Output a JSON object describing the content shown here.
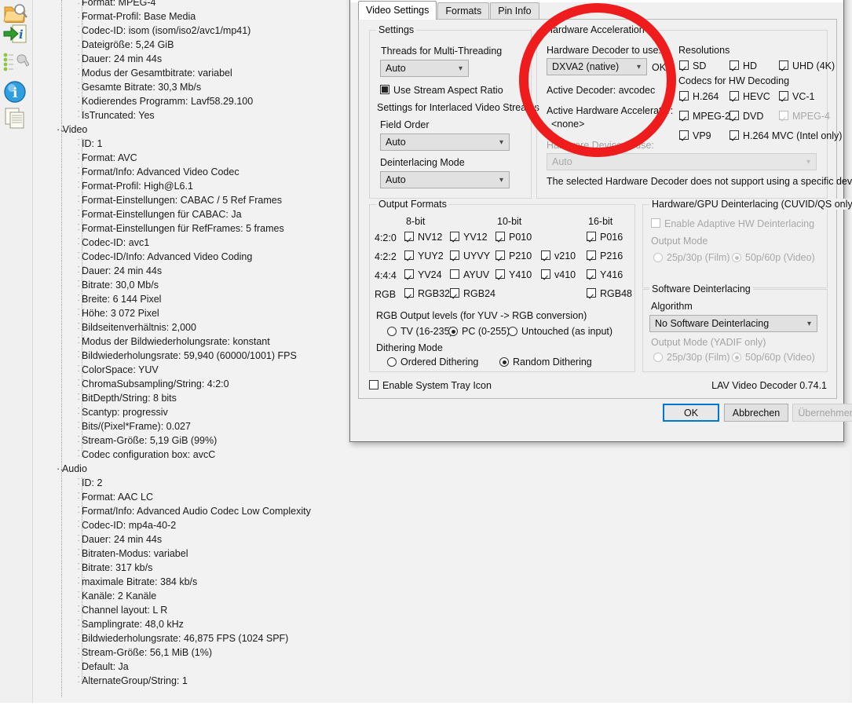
{
  "app": {
    "rail_icons": [
      {
        "name": "folder-search-icon"
      },
      {
        "name": "import-info-icon"
      },
      {
        "name": "tools-wrench-icon"
      },
      {
        "name": "info-circle-icon"
      },
      {
        "name": "copy-document-icon"
      }
    ]
  },
  "tree": {
    "groups": [
      {
        "label": "",
        "items": [
          "Format: MPEG-4",
          "Format-Profil: Base Media",
          "Codec-ID: isom (isom/iso2/avc1/mp41)",
          "Dateigröße: 5,24 GiB",
          "Dauer: 24 min 44s",
          "Modus der Gesamtbitrate: variabel",
          "Gesamte Bitrate: 30,3 Mb/s",
          "Kodierendes Programm: Lavf58.29.100",
          "IsTruncated: Yes"
        ]
      },
      {
        "label": "Video",
        "items": [
          "ID: 1",
          "Format: AVC",
          "Format/Info: Advanced Video Codec",
          "Format-Profil: High@L6.1",
          "Format-Einstellungen: CABAC / 5 Ref Frames",
          "Format-Einstellungen für CABAC: Ja",
          "Format-Einstellungen für RefFrames: 5 frames",
          "Codec-ID: avc1",
          "Codec-ID/Info: Advanced Video Coding",
          "Dauer: 24 min 44s",
          "Bitrate: 30,0 Mb/s",
          "Breite: 6 144 Pixel",
          "Höhe: 3 072 Pixel",
          "Bildseitenverhältnis: 2,000",
          "Modus der Bildwiederholungsrate: konstant",
          "Bildwiederholungsrate: 59,940 (60000/1001) FPS",
          "ColorSpace: YUV",
          "ChromaSubsampling/String: 4:2:0",
          "BitDepth/String: 8 bits",
          "Scantyp: progressiv",
          "Bits/(Pixel*Frame): 0.027",
          "Stream-Größe: 5,19 GiB (99%)",
          "Codec configuration box: avcC"
        ]
      },
      {
        "label": "Audio",
        "items": [
          "ID: 2",
          "Format: AAC LC",
          "Format/Info: Advanced Audio Codec Low Complexity",
          "Codec-ID: mp4a-40-2",
          "Dauer: 24 min 44s",
          "Bitraten-Modus: variabel",
          "Bitrate: 317 kb/s",
          "maximale Bitrate: 384 kb/s",
          "Kanäle: 2 Kanäle",
          "Channel layout: L R",
          "Samplingrate: 48,0 kHz",
          "Bildwiederholungsrate: 46,875 FPS (1024 SPF)",
          "Stream-Größe: 56,1 MiB (1%)",
          "Default: Ja",
          "AlternateGroup/String: 1"
        ]
      }
    ]
  },
  "dialog": {
    "title": "",
    "tabs": [
      {
        "label": "Video Settings",
        "active": true
      },
      {
        "label": "Formats",
        "active": false
      },
      {
        "label": "Pin Info",
        "active": false
      }
    ],
    "settings_group": {
      "legend": "Settings",
      "threads_label": "Threads for Multi-Threading",
      "threads_value": "Auto",
      "use_stream_aspect_ratio": "Use Stream Aspect Ratio",
      "interlaced_label": "Settings for Interlaced Video Streams",
      "field_order_label": "Field Order",
      "field_order_value": "Auto",
      "deinterlacing_mode_label": "Deinterlacing Mode",
      "deinterlacing_mode_value": "Auto"
    },
    "hwaccel_group": {
      "legend": "Hardware Acceleration",
      "decoder_label": "Hardware Decoder to use:",
      "decoder_value": "DXVA2 (native)",
      "decoder_status": "OK",
      "active_decoder_label": "Active Decoder:  avcodec",
      "active_accel_label": "Active Hardware Accelerator:",
      "active_accel_value": "<none>",
      "device_label": "Hardware Device to use:",
      "device_value": "Auto",
      "device_note": "The selected Hardware Decoder does not support using a specific device.",
      "resolutions_label": "Resolutions",
      "resolutions": [
        {
          "label": "SD",
          "checked": true,
          "enabled": true
        },
        {
          "label": "HD",
          "checked": true,
          "enabled": true
        },
        {
          "label": "UHD (4K)",
          "checked": true,
          "enabled": true
        }
      ],
      "codecs_label": "Codecs for HW Decoding",
      "codecs": [
        {
          "label": "H.264",
          "checked": true,
          "enabled": true
        },
        {
          "label": "HEVC",
          "checked": true,
          "enabled": true
        },
        {
          "label": "VC-1",
          "checked": true,
          "enabled": true
        },
        {
          "label": "MPEG-2",
          "checked": true,
          "enabled": true
        },
        {
          "label": "DVD",
          "checked": true,
          "enabled": true
        },
        {
          "label": "MPEG-4",
          "checked": true,
          "enabled": false
        },
        {
          "label": "VP9",
          "checked": true,
          "enabled": true
        },
        {
          "label": "H.264 MVC (Intel only)",
          "checked": true,
          "enabled": true
        }
      ]
    },
    "output_formats": {
      "legend": "Output Formats",
      "bit_headers": [
        "8-bit",
        "10-bit",
        "16-bit"
      ],
      "rows": [
        {
          "name": "4:2:0",
          "cells": [
            {
              "label": "NV12",
              "checked": true
            },
            {
              "label": "YV12",
              "checked": true
            },
            {
              "label": "P010",
              "checked": true
            },
            {
              "label": "",
              "checked": null
            },
            {
              "label": "P016",
              "checked": true
            }
          ]
        },
        {
          "name": "4:2:2",
          "cells": [
            {
              "label": "YUY2",
              "checked": true
            },
            {
              "label": "UYVY",
              "checked": true
            },
            {
              "label": "P210",
              "checked": true
            },
            {
              "label": "v210",
              "checked": true
            },
            {
              "label": "P216",
              "checked": true
            }
          ]
        },
        {
          "name": "4:4:4",
          "cells": [
            {
              "label": "YV24",
              "checked": true
            },
            {
              "label": "AYUV",
              "checked": false
            },
            {
              "label": "Y410",
              "checked": true
            },
            {
              "label": "v410",
              "checked": true
            },
            {
              "label": "Y416",
              "checked": true
            }
          ]
        },
        {
          "name": "RGB",
          "cells": [
            {
              "label": "RGB32",
              "checked": true
            },
            {
              "label": "RGB24",
              "checked": true
            },
            {
              "label": "",
              "checked": null
            },
            {
              "label": "",
              "checked": null
            },
            {
              "label": "RGB48",
              "checked": true
            }
          ]
        }
      ],
      "rgb_levels_label": "RGB Output levels (for YUV -> RGB conversion)",
      "rgb_levels": [
        {
          "label": "TV (16-235)",
          "selected": false
        },
        {
          "label": "PC (0-255)",
          "selected": true
        },
        {
          "label": "Untouched (as input)",
          "selected": false
        }
      ],
      "dithering_label": "Dithering Mode",
      "dithering": [
        {
          "label": "Ordered Dithering",
          "selected": false
        },
        {
          "label": "Random Dithering",
          "selected": true
        }
      ]
    },
    "hw_deint": {
      "legend": "Hardware/GPU Deinterlacing (CUVID/QS only)",
      "enable_adaptive": "Enable Adaptive HW Deinterlacing",
      "output_mode_label": "Output Mode",
      "modes": [
        {
          "label": "25p/30p (Film)",
          "selected": false
        },
        {
          "label": "50p/60p (Video)",
          "selected": true
        }
      ]
    },
    "sw_deint": {
      "legend": "Software Deinterlacing",
      "algorithm_label": "Algorithm",
      "algorithm_value": "No Software Deinterlacing",
      "output_mode_label": "Output Mode (YADIF only)",
      "modes": [
        {
          "label": "25p/30p (Film)",
          "selected": false
        },
        {
          "label": "50p/60p (Video)",
          "selected": true
        }
      ]
    },
    "tray_icon_label": "Enable System Tray Icon",
    "version_text": "LAV Video Decoder 0.74.1",
    "buttons": {
      "ok": "OK",
      "cancel": "Abbrechen",
      "apply": "Übernehmen"
    }
  },
  "annotation": {
    "shape": "red-ellipse-highlight",
    "color": "#ee1c1c"
  }
}
